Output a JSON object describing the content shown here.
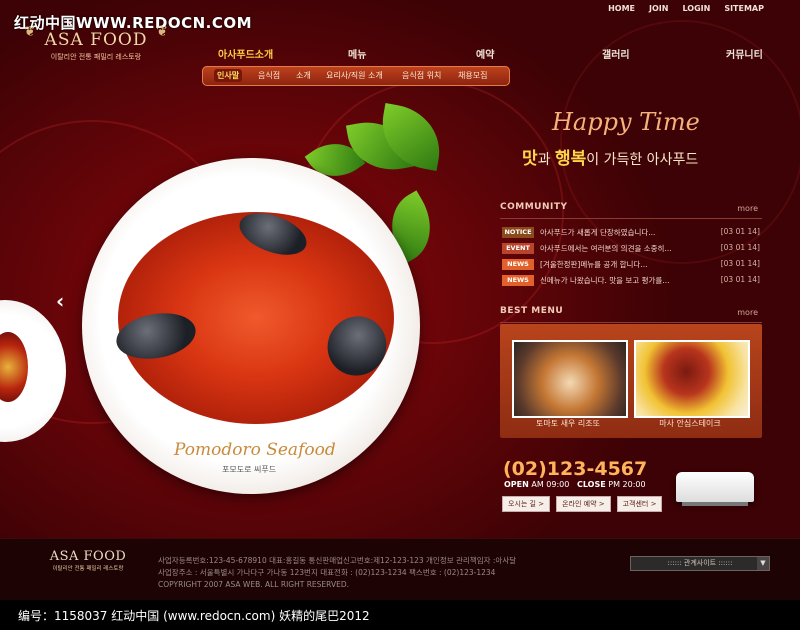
{
  "watermark": "红动中国WWW.REDOCN.COM",
  "topnav": [
    "HOME",
    "JOIN",
    "LOGIN",
    "SITEMAP"
  ],
  "logo": {
    "brand": "ASA FOOD",
    "tagline": "이탈리안 전통 패밀리 레스토랑"
  },
  "mainnav": [
    "아사푸드소개",
    "메뉴",
    "예약",
    "갤러리",
    "커뮤니티"
  ],
  "subnav": [
    "인사말",
    "음식점",
    "소개",
    "요리사/직원 소개",
    "음식점 위치",
    "채용모집"
  ],
  "hero": {
    "dish_name": "Pomodoro Seafood",
    "dish_sub": "포모도로 씨푸드"
  },
  "happy_time": "Happy Time",
  "slogan": {
    "a": "맛",
    "b": "과 ",
    "c": "행복",
    "d": "이 가득한 아사푸드"
  },
  "community": {
    "title": "COMMUNITY",
    "more": "more",
    "items": [
      {
        "tag": "NOTICE",
        "tag_color": "#8a4a1c",
        "text": "아사푸드가 새롭게 단장하였습니다...",
        "date": "[03 01 14]"
      },
      {
        "tag": "EVENT",
        "tag_color": "#b8442c",
        "text": "아사푸드에서는 여러분의 의견을 소중히...",
        "date": "[03 01 14]"
      },
      {
        "tag": "NEWS",
        "tag_color": "#e2602a",
        "text": "[겨울한정판]메뉴를 공개 합니다...",
        "date": "[03 01 14]"
      },
      {
        "tag": "NEWS",
        "tag_color": "#e2602a",
        "text": "신메뉴가 나왔습니다. 맛을 보고 평가를...",
        "date": "[03 01 14]"
      }
    ]
  },
  "best_menu": {
    "title": "BEST MENU",
    "more": "more",
    "items": [
      {
        "label": "토마토 새우 리조또"
      },
      {
        "label": "마사 안심스테이크"
      }
    ]
  },
  "contact": {
    "phone": "(02)123-4567",
    "open_label": "OPEN",
    "open_time": "AM 09:00",
    "close_label": "CLOSE",
    "close_time": "PM 20:00",
    "buttons": [
      "오시는 길 >",
      "온라인 예약 >",
      "고객센터 >"
    ]
  },
  "footer": {
    "brand": "ASA FOOD",
    "tagline": "이탈리안 전통 패밀리 레스토랑",
    "line1": "사업자등록번호:123-45-678910 대표:홍길동 통신판매업신고번호:제12-123-123 개인정보 관리책임자 :아사달",
    "line2": "사업장주소 : 서울특별시 가나다구 가나동 123번지 대표전화 : (02)123-1234 팩스번호 : (02)123-1234",
    "line3": "COPYRIGHT 2007 ASA WEB. ALL RIGHT RESERVED.",
    "related_sites": ":::::: 관계사이트 ::::::"
  },
  "bottom_info": "编号：1158037    红动中国 (www.redocn.com)    妖精的尾巴2012"
}
